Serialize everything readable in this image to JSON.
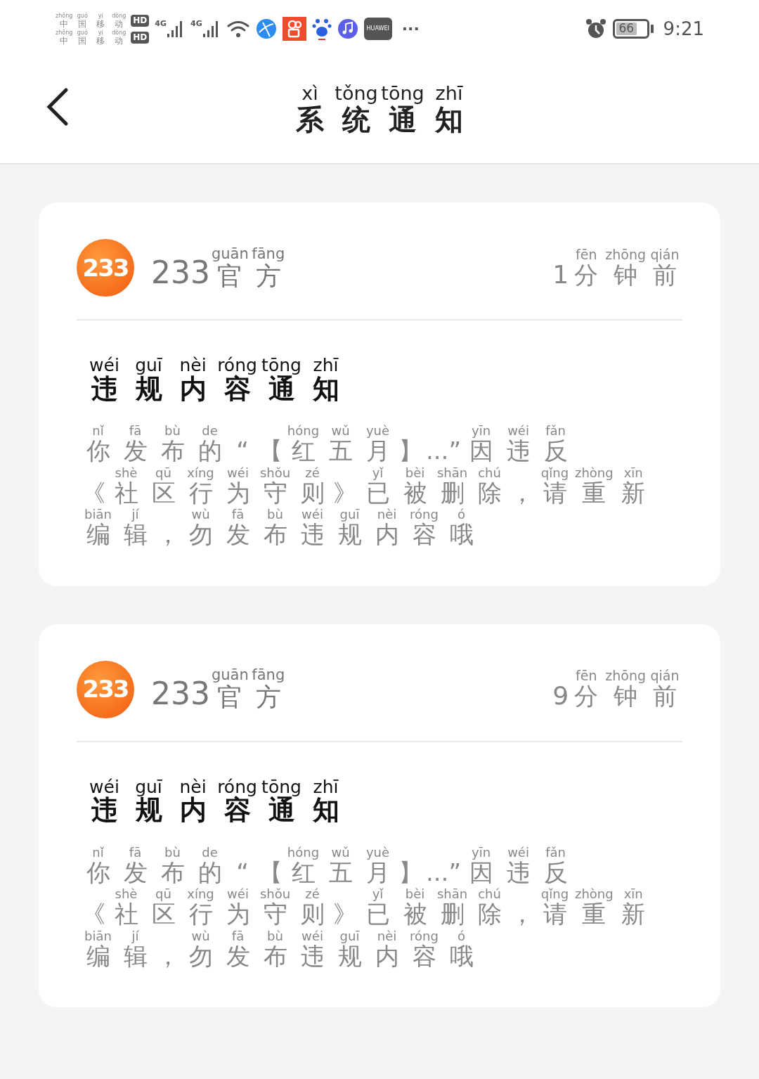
{
  "status_bar": {
    "carriers": [
      {
        "name": [
          [
            "zhōng",
            "中"
          ],
          [
            "guó",
            "国"
          ],
          [
            "yí",
            "移"
          ],
          [
            "dòng",
            "动"
          ]
        ],
        "badge": "HD"
      },
      {
        "name": [
          [
            "zhōng",
            "中"
          ],
          [
            "guó",
            "国"
          ],
          [
            "yí",
            "移"
          ],
          [
            "dòng",
            "动"
          ]
        ],
        "badge": "HD"
      }
    ],
    "networks": [
      "4G",
      "4G"
    ],
    "store_label": "HUAWEI",
    "more": "···",
    "battery": "66",
    "time": "9:21"
  },
  "header": {
    "title": [
      [
        "xì",
        "系"
      ],
      [
        "tǒng",
        "统"
      ],
      [
        "tōng",
        "通"
      ],
      [
        "zhī",
        "知"
      ]
    ]
  },
  "notifications": [
    {
      "logo": "233",
      "sender_prefix": "233",
      "sender": [
        [
          "guān",
          "官"
        ],
        [
          "fāng",
          "方"
        ]
      ],
      "time_prefix": "1",
      "time": [
        [
          "fēn",
          "分"
        ],
        [
          "zhōng",
          "钟"
        ],
        [
          "qián",
          "前"
        ]
      ],
      "heading": [
        [
          "wéi",
          "违"
        ],
        [
          "guī",
          "规"
        ],
        [
          "nèi",
          "内"
        ],
        [
          "róng",
          "容"
        ],
        [
          "tōng",
          "通"
        ],
        [
          "zhī",
          "知"
        ]
      ],
      "body_lines": [
        [
          [
            "nǐ",
            "你"
          ],
          [
            "fā",
            "发"
          ],
          [
            "bù",
            "布"
          ],
          [
            "de",
            "的"
          ],
          [
            "“"
          ],
          [
            "【"
          ],
          [
            "hóng",
            "红"
          ],
          [
            "wǔ",
            "五"
          ],
          [
            "yuè",
            "月"
          ],
          [
            "】"
          ],
          [
            "...”"
          ],
          [
            "yīn",
            "因"
          ],
          [
            "wéi",
            "违"
          ],
          [
            "fǎn",
            "反"
          ]
        ],
        [
          [
            "《"
          ],
          [
            "shè",
            "社"
          ],
          [
            "qū",
            "区"
          ],
          [
            "xíng",
            "行"
          ],
          [
            "wéi",
            "为"
          ],
          [
            "shǒu",
            "守"
          ],
          [
            "zé",
            "则"
          ],
          [
            "》"
          ],
          [
            "yǐ",
            "已"
          ],
          [
            "bèi",
            "被"
          ],
          [
            "shān",
            "删"
          ],
          [
            "chú",
            "除"
          ],
          [
            "，"
          ],
          [
            "qǐng",
            "请"
          ],
          [
            "zhòng",
            "重"
          ],
          [
            "xīn",
            "新"
          ]
        ],
        [
          [
            "biān",
            "编"
          ],
          [
            "jí",
            "辑"
          ],
          [
            "，"
          ],
          [
            "wù",
            "勿"
          ],
          [
            "fā",
            "发"
          ],
          [
            "bù",
            "布"
          ],
          [
            "wéi",
            "违"
          ],
          [
            "guī",
            "规"
          ],
          [
            "nèi",
            "内"
          ],
          [
            "róng",
            "容"
          ],
          [
            "ó",
            "哦"
          ]
        ]
      ]
    },
    {
      "logo": "233",
      "sender_prefix": "233",
      "sender": [
        [
          "guān",
          "官"
        ],
        [
          "fāng",
          "方"
        ]
      ],
      "time_prefix": "9",
      "time": [
        [
          "fēn",
          "分"
        ],
        [
          "zhōng",
          "钟"
        ],
        [
          "qián",
          "前"
        ]
      ],
      "heading": [
        [
          "wéi",
          "违"
        ],
        [
          "guī",
          "规"
        ],
        [
          "nèi",
          "内"
        ],
        [
          "róng",
          "容"
        ],
        [
          "tōng",
          "通"
        ],
        [
          "zhī",
          "知"
        ]
      ],
      "body_lines": [
        [
          [
            "nǐ",
            "你"
          ],
          [
            "fā",
            "发"
          ],
          [
            "bù",
            "布"
          ],
          [
            "de",
            "的"
          ],
          [
            "“"
          ],
          [
            "【"
          ],
          [
            "hóng",
            "红"
          ],
          [
            "wǔ",
            "五"
          ],
          [
            "yuè",
            "月"
          ],
          [
            "】"
          ],
          [
            "...”"
          ],
          [
            "yīn",
            "因"
          ],
          [
            "wéi",
            "违"
          ],
          [
            "fǎn",
            "反"
          ]
        ],
        [
          [
            "《"
          ],
          [
            "shè",
            "社"
          ],
          [
            "qū",
            "区"
          ],
          [
            "xíng",
            "行"
          ],
          [
            "wéi",
            "为"
          ],
          [
            "shǒu",
            "守"
          ],
          [
            "zé",
            "则"
          ],
          [
            "》"
          ],
          [
            "yǐ",
            "已"
          ],
          [
            "bèi",
            "被"
          ],
          [
            "shān",
            "删"
          ],
          [
            "chú",
            "除"
          ],
          [
            "，"
          ],
          [
            "qǐng",
            "请"
          ],
          [
            "zhòng",
            "重"
          ],
          [
            "xīn",
            "新"
          ]
        ],
        [
          [
            "biān",
            "编"
          ],
          [
            "jí",
            "辑"
          ],
          [
            "，"
          ],
          [
            "wù",
            "勿"
          ],
          [
            "fā",
            "发"
          ],
          [
            "bù",
            "布"
          ],
          [
            "wéi",
            "违"
          ],
          [
            "guī",
            "规"
          ],
          [
            "nèi",
            "内"
          ],
          [
            "róng",
            "容"
          ],
          [
            "ó",
            "哦"
          ]
        ]
      ]
    }
  ]
}
